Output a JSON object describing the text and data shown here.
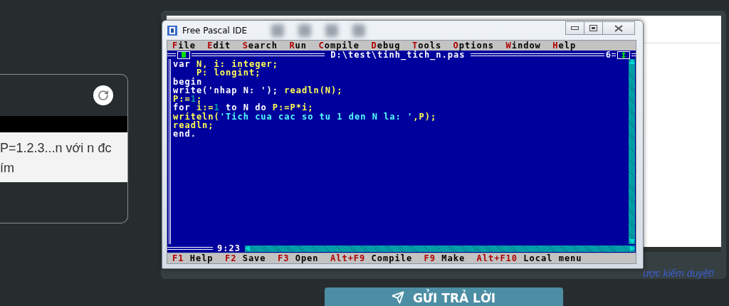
{
  "left_card": {
    "text_lines": [
      "P=1.2.3...n với n đc",
      "ím"
    ]
  },
  "ide_window": {
    "title": "Free Pascal IDE",
    "menu": [
      "File",
      "Edit",
      "Search",
      "Run",
      "Compile",
      "Debug",
      "Tools",
      "Options",
      "Window",
      "Help"
    ],
    "editor": {
      "file_path": "D:\\test\\tinh_tich_n.pas",
      "window_number": "6",
      "cursor_position": "9:23",
      "lines": [
        [
          {
            "kind": "keyword",
            "text": "var "
          },
          {
            "kind": "identifier",
            "text": "N, i: integer;"
          }
        ],
        [
          {
            "kind": "identifier",
            "text": "    P: longint;"
          }
        ],
        [
          {
            "kind": "keyword",
            "text": "begin"
          }
        ],
        [
          {
            "kind": "keyword",
            "text": "write('nhap N: '); "
          },
          {
            "kind": "identifier",
            "text": "readln(N);"
          }
        ],
        [
          {
            "kind": "identifier",
            "text": "P:="
          },
          {
            "kind": "number",
            "text": "1"
          },
          {
            "kind": "identifier",
            "text": ";"
          }
        ],
        [
          {
            "kind": "keyword",
            "text": "for "
          },
          {
            "kind": "identifier",
            "text": "i:="
          },
          {
            "kind": "number",
            "text": "1"
          },
          {
            "kind": "keyword",
            "text": " to N do "
          },
          {
            "kind": "identifier",
            "text": "P:=P*i;"
          }
        ],
        [
          {
            "kind": "identifier",
            "text": "writeln("
          },
          {
            "kind": "string",
            "text": "'Tich cua cac so tu 1 den N la: '"
          },
          {
            "kind": "identifier",
            "text": ",P);"
          }
        ],
        [
          {
            "kind": "identifier",
            "text": "readln;"
          }
        ],
        [
          {
            "kind": "keyword",
            "text": "end."
          }
        ]
      ]
    },
    "status_bar": [
      {
        "key": "F1",
        "label": "Help"
      },
      {
        "key": "F2",
        "label": "Save"
      },
      {
        "key": "F3",
        "label": "Open"
      },
      {
        "key": "Alt+F9",
        "label": "Compile"
      },
      {
        "key": "F9",
        "label": "Make"
      },
      {
        "key": "Alt+F10",
        "label": "Local menu"
      }
    ]
  },
  "answer_panel": {
    "notice": "ược kiểm duyệt!"
  },
  "submit_button": {
    "label": "GỬI TRẢ LỜI"
  }
}
